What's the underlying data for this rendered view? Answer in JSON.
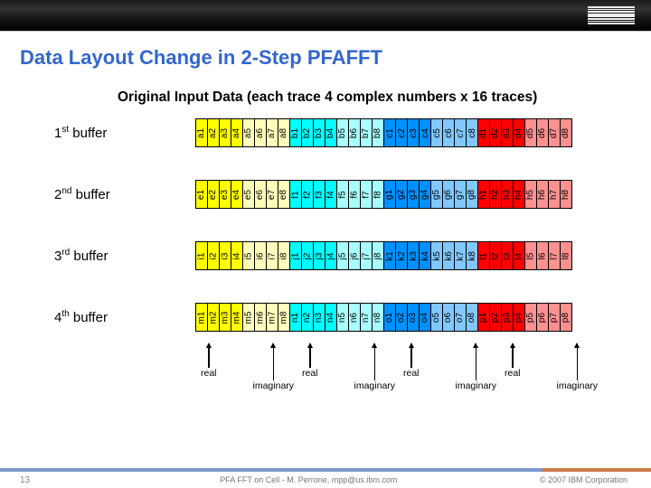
{
  "brand": "IBM",
  "title": "Data Layout Change in 2-Step PFAFFT",
  "subtitle": "Original Input Data (each trace 4 complex numbers x 16 traces)",
  "buffers": [
    {
      "label_pre": "1",
      "label_sup": "st",
      "label_post": " buffer",
      "letters": [
        "a",
        "b",
        "c",
        "d"
      ]
    },
    {
      "label_pre": "2",
      "label_sup": "nd",
      "label_post": " buffer",
      "letters": [
        "e",
        "f",
        "g",
        "h"
      ]
    },
    {
      "label_pre": "3",
      "label_sup": "rd",
      "label_post": " buffer",
      "letters": [
        "i",
        "j",
        "k",
        "l"
      ]
    },
    {
      "label_pre": "4",
      "label_sup": "th",
      "label_post": " buffer",
      "letters": [
        "m",
        "n",
        "o",
        "p"
      ]
    }
  ],
  "labels": {
    "real": "real",
    "imaginary": "imaginary"
  },
  "page_number": "13",
  "footer_center": "PFA FFT on Cell - M. Perrone,  mpp@us.ibm.com",
  "footer_right": "© 2007 IBM Corporation",
  "chart_data": {
    "type": "table",
    "description": "Four buffers, each containing 32 cells. Each group of 8 cells is labeled letterN where N=1..8. Groups colored yellow,cyan,blue,red alternating real/imaginary halves (1-4 real, 5-8 imaginary).",
    "rows": [
      {
        "buffer": "1st",
        "groups": [
          "a",
          "b",
          "c",
          "d"
        ],
        "colors": [
          "yellow",
          "cyan",
          "blue",
          "red"
        ]
      },
      {
        "buffer": "2nd",
        "groups": [
          "e",
          "f",
          "g",
          "h"
        ],
        "colors": [
          "yellow",
          "cyan",
          "blue",
          "red"
        ]
      },
      {
        "buffer": "3rd",
        "groups": [
          "i",
          "j",
          "k",
          "l"
        ],
        "colors": [
          "yellow",
          "cyan",
          "blue",
          "red"
        ]
      },
      {
        "buffer": "4th",
        "groups": [
          "m",
          "n",
          "o",
          "p"
        ],
        "colors": [
          "yellow",
          "cyan",
          "blue",
          "red"
        ]
      }
    ],
    "cell_indices": [
      1,
      2,
      3,
      4,
      5,
      6,
      7,
      8
    ],
    "annotation": "First 4 of each group = real, last 4 = imaginary"
  }
}
